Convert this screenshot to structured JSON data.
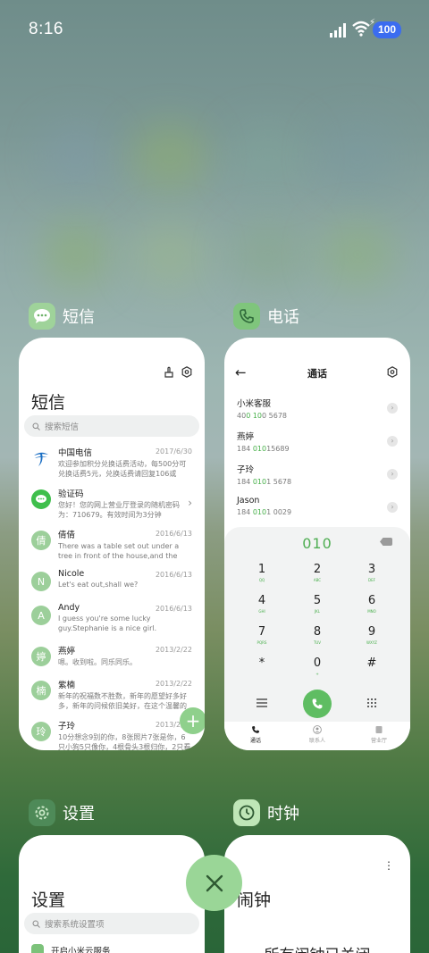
{
  "status_bar": {
    "time": "8:16",
    "battery": "100"
  },
  "apps": {
    "sms": {
      "name": "短信",
      "title": "短信",
      "search_placeholder": "搜索短信",
      "messages": [
        {
          "sender": "中国电信",
          "date": "2017/6/30",
          "preview": "欢迎参加积分兑换话费活动，每500分可兑换话费5元，兑换话费请回复106或jfdh#话费…",
          "avatar": "telecom"
        },
        {
          "sender": "验证码",
          "date": "",
          "preview": "您好！您的网上营业厅登录的随机密码为：710679。有效时间为3分钟",
          "avatar": "chat"
        },
        {
          "sender": "倩倩",
          "date": "2016/6/13",
          "preview": "There was a table set out under a tree in front of the house,and the March Hare an…",
          "avatar": "倩"
        },
        {
          "sender": "Nicole",
          "date": "2016/6/13",
          "preview": "Let's eat out,shall we?",
          "avatar": "N"
        },
        {
          "sender": "Andy",
          "date": "2016/6/13",
          "preview": "I guess you're some lucky guy.Stephanie is a nice girl.",
          "avatar": "A"
        },
        {
          "sender": "燕婷",
          "date": "2013/2/22",
          "preview": "嗯。收到啦。同乐同乐。",
          "avatar": "婷"
        },
        {
          "sender": "紫楠",
          "date": "2013/2/22",
          "preview": "新年的祝福数不胜数，新年的愿望好多好多，新年的问候依旧美好，在这个温馨的时刻…",
          "avatar": "楠"
        },
        {
          "sender": "子玲",
          "date": "2013/2/22",
          "preview": "10分想念9别的你，8张照片7张是你，6只小狗5只像你，4根骨头3根归你，2只看着1定…",
          "avatar": "玲"
        }
      ]
    },
    "phone": {
      "name": "电话",
      "title": "通话",
      "contacts": [
        {
          "name": "小米客服",
          "number_pre": "40",
          "number_hl": "0 10",
          "number_post": "0 5678"
        },
        {
          "name": "燕婷",
          "number_pre": "184 ",
          "number_hl": "010",
          "number_post": "15689"
        },
        {
          "name": "子玲",
          "number_pre": "184 ",
          "number_hl": "010",
          "number_post": "1 5678"
        },
        {
          "name": "Jason",
          "number_pre": "184 ",
          "number_hl": "010",
          "number_post": "1 0029"
        }
      ],
      "dialed": "010",
      "keys": [
        {
          "d": "1",
          "l": "QQ"
        },
        {
          "d": "2",
          "l": "ABC"
        },
        {
          "d": "3",
          "l": "DEF"
        },
        {
          "d": "4",
          "l": "GHI"
        },
        {
          "d": "5",
          "l": "JKL"
        },
        {
          "d": "6",
          "l": "MNO"
        },
        {
          "d": "7",
          "l": "PQRS"
        },
        {
          "d": "8",
          "l": "TUV"
        },
        {
          "d": "9",
          "l": "WXYZ"
        },
        {
          "d": "*",
          "l": ""
        },
        {
          "d": "0",
          "l": "+"
        },
        {
          "d": "#",
          "l": ""
        }
      ],
      "tabs": [
        "通话",
        "联系人",
        "营业厅"
      ]
    },
    "settings": {
      "name": "设置",
      "title": "设置",
      "search_placeholder": "搜索系统设置项",
      "first_item": "开启小米云服务"
    },
    "clock": {
      "name": "时钟",
      "title": "闹钟",
      "empty_text": "所有闹钟已关闭"
    }
  },
  "colors": {
    "accent": "#5fbd62",
    "close_button": "#9ad697"
  }
}
